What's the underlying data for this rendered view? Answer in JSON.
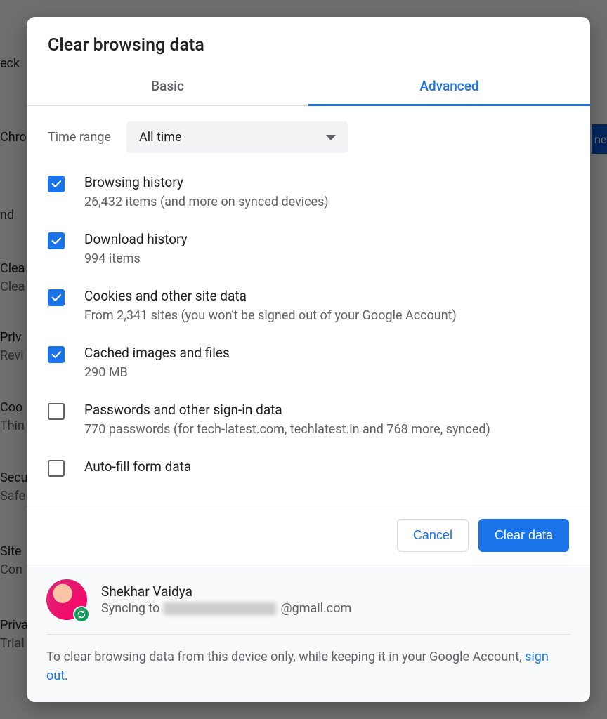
{
  "dialog": {
    "title": "Clear browsing data",
    "tabs": {
      "basic": "Basic",
      "advanced": "Advanced"
    },
    "timerange": {
      "label": "Time range",
      "value": "All time"
    },
    "items": [
      {
        "checked": true,
        "title": "Browsing history",
        "sub": "26,432 items (and more on synced devices)"
      },
      {
        "checked": true,
        "title": "Download history",
        "sub": "994 items"
      },
      {
        "checked": true,
        "title": "Cookies and other site data",
        "sub": "From 2,341 sites (you won't be signed out of your Google Account)"
      },
      {
        "checked": true,
        "title": "Cached images and files",
        "sub": "290 MB"
      },
      {
        "checked": false,
        "title": "Passwords and other sign-in data",
        "sub": "770 passwords (for tech-latest.com, techlatest.in and 768 more, synced)"
      },
      {
        "checked": false,
        "title": "Auto-fill form data",
        "sub": ""
      }
    ],
    "buttons": {
      "cancel": "Cancel",
      "clear": "Clear data"
    },
    "account": {
      "name": "Shekhar Vaidya",
      "syncing_prefix": "Syncing to ",
      "email_suffix": "@gmail.com",
      "note_pre": "To clear browsing data from this device only, while keeping it in your Google Account, ",
      "note_link": "sign out",
      "note_post": "."
    }
  },
  "bg_labels": [
    "eck",
    "Chro",
    "nd",
    "Clea",
    "Clea",
    "Priv",
    "Revi",
    "Coo",
    "Thin",
    "Secu",
    "Safe",
    "Site",
    "Con",
    "Priva",
    "Trial",
    "ne"
  ]
}
